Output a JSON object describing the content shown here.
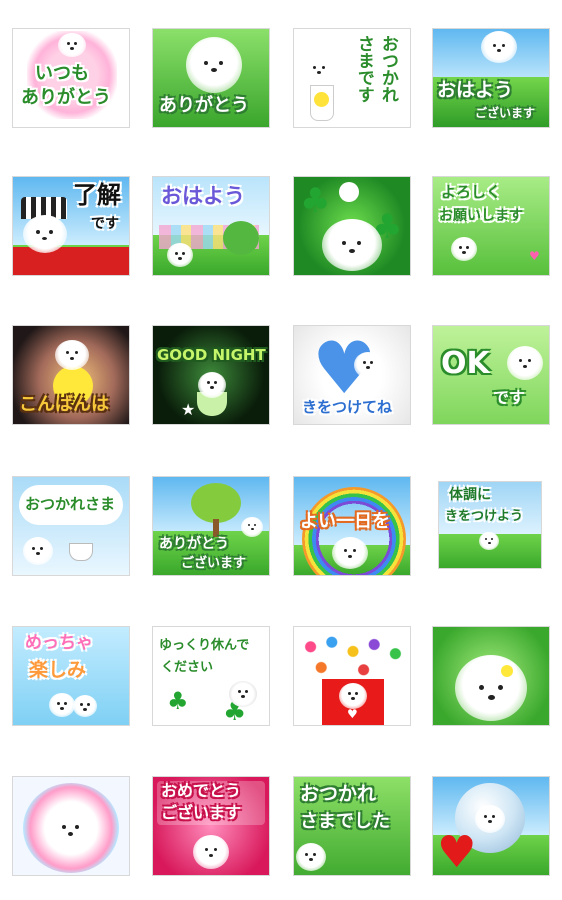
{
  "stickers": [
    {
      "id": "t1",
      "lines": [
        "いつも",
        "ありがとう"
      ]
    },
    {
      "id": "t2",
      "lines": [
        "ありがとう"
      ]
    },
    {
      "id": "t3",
      "lines": [
        "おつかれ",
        "さまです"
      ]
    },
    {
      "id": "t4",
      "lines": [
        "おはよう",
        "ございます"
      ]
    },
    {
      "id": "t5",
      "lines": [
        "了解",
        "です"
      ]
    },
    {
      "id": "t6",
      "lines": [
        "おはよう"
      ]
    },
    {
      "id": "t7",
      "lines": []
    },
    {
      "id": "t8",
      "lines": [
        "よろしく",
        "お願いします"
      ]
    },
    {
      "id": "t9",
      "lines": [
        "こんばんは"
      ]
    },
    {
      "id": "t10",
      "lines": [
        "GOOD NIGHT"
      ]
    },
    {
      "id": "t11",
      "lines": [
        "きをつけてね"
      ]
    },
    {
      "id": "t12",
      "lines": [
        "OK",
        "です"
      ]
    },
    {
      "id": "t13",
      "lines": [
        "おつかれさま"
      ]
    },
    {
      "id": "t14",
      "lines": [
        "ありがとう",
        "ございます"
      ]
    },
    {
      "id": "t15",
      "lines": [
        "よい一日を"
      ]
    },
    {
      "id": "t16",
      "lines": [
        "体調に",
        "きをつけよう"
      ]
    },
    {
      "id": "t17",
      "lines": [
        "めっちゃ",
        "楽しみ"
      ]
    },
    {
      "id": "t18",
      "lines": [
        "ゆっくり休んで",
        "ください"
      ]
    },
    {
      "id": "t19",
      "lines": []
    },
    {
      "id": "t20",
      "lines": []
    },
    {
      "id": "t21",
      "lines": []
    },
    {
      "id": "t22",
      "lines": [
        "おめでとう",
        "ございます"
      ]
    },
    {
      "id": "t23",
      "lines": [
        "おつかれ",
        "さまでした"
      ]
    },
    {
      "id": "t24",
      "lines": []
    }
  ]
}
